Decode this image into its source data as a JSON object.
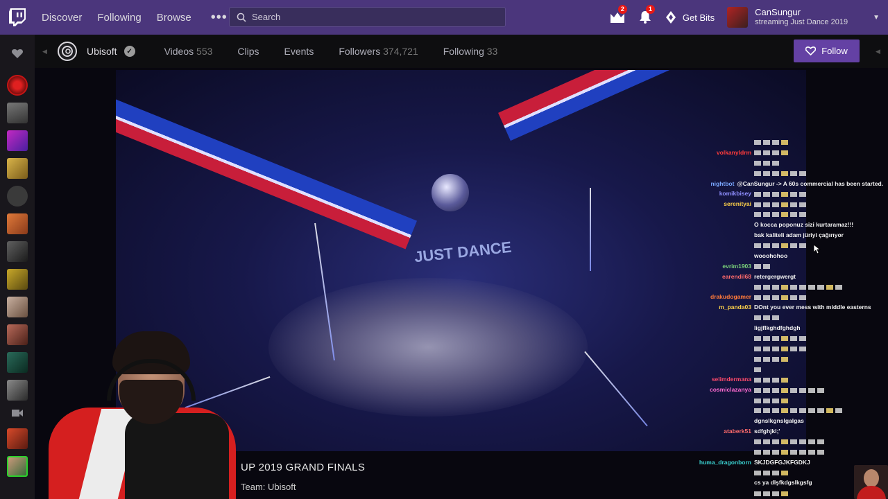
{
  "nav": {
    "links": [
      "Discover",
      "Following",
      "Browse"
    ],
    "search_placeholder": "Search",
    "prime_badge": "2",
    "notif_badge": "1",
    "bits_label": "Get Bits",
    "user_name": "CanSungur",
    "user_status": "streaming Just Dance 2019"
  },
  "channel": {
    "name": "Ubisoft",
    "tabs": [
      {
        "label": "Videos",
        "count": "553"
      },
      {
        "label": "Clips",
        "count": ""
      },
      {
        "label": "Events",
        "count": ""
      },
      {
        "label": "Followers",
        "count": "374,721"
      },
      {
        "label": "Following",
        "count": "33"
      }
    ],
    "follow_label": "Follow"
  },
  "video": {
    "caption_title": "UP 2019 GRAND FINALS",
    "caption_team": "Team:  Ubisoft"
  },
  "chat": [
    {
      "user": "",
      "color": "#e0e0e0",
      "text": "",
      "emotes": 4
    },
    {
      "user": "volkanyldrm",
      "color": "#ff3b3b",
      "text": "",
      "emotes": 4
    },
    {
      "user": "",
      "color": "#e0e0e0",
      "text": "",
      "emotes": 3
    },
    {
      "user": "",
      "color": "#ff3b3b",
      "text": "",
      "emotes": 6
    },
    {
      "user": "nightbot",
      "color": "#7aa7ff",
      "text": "@CanSungur -> A 60s commercial has been started.",
      "emotes": 0
    },
    {
      "user": "komikbisey",
      "color": "#8f8fff",
      "text": "",
      "emotes": 6
    },
    {
      "user": "serenityai",
      "color": "#ffd24a",
      "text": "",
      "emotes": 6
    },
    {
      "user": "",
      "color": "#e0e0e0",
      "text": "",
      "emotes": 6
    },
    {
      "user": "",
      "color": "#ff3b3b",
      "text": "O kocca poponuz sizi kurtaramaz!!!",
      "emotes": 0
    },
    {
      "user": "",
      "color": "#3ad13a",
      "text": "bak kaliteli adam jüriyi çağırıyor",
      "emotes": 0
    },
    {
      "user": "",
      "color": "#ff3b3b",
      "text": "",
      "emotes": 6
    },
    {
      "user": "",
      "color": "#b36bff",
      "text": "wooohohoo",
      "emotes": 0
    },
    {
      "user": "evrim1903",
      "color": "#7ad17a",
      "text": "",
      "emotes": 2
    },
    {
      "user": "earendil68",
      "color": "#ff6b6b",
      "text": "retergergwergt",
      "emotes": 0
    },
    {
      "user": "",
      "color": "#ff3b3b",
      "text": "",
      "emotes": 10
    },
    {
      "user": "drakudogamer",
      "color": "#ff7a3a",
      "text": "",
      "emotes": 6
    },
    {
      "user": "m_panda03",
      "color": "#ffd24a",
      "text": "DOnt you ever mess with middle easterns",
      "emotes": 0
    },
    {
      "user": "",
      "color": "#4a9aff",
      "text": "",
      "emotes": 3
    },
    {
      "user": "",
      "color": "#e0e0e0",
      "text": "ligjflkghdfghdgh",
      "emotes": 0
    },
    {
      "user": "",
      "color": "#b36bff",
      "text": "",
      "emotes": 6
    },
    {
      "user": "",
      "color": "#ff3b3b",
      "text": "",
      "emotes": 6
    },
    {
      "user": "",
      "color": "#ff3b3b",
      "text": "",
      "emotes": 4
    },
    {
      "user": "",
      "color": "#e0e0e0",
      "text": "",
      "emotes": 1
    },
    {
      "user": "selimdermana",
      "color": "#ff4a6b",
      "text": "",
      "emotes": 4
    },
    {
      "user": "cosmiclazanya",
      "color": "#ff6bd1",
      "text": "",
      "emotes": 8
    },
    {
      "user": "",
      "color": "#ff3b3b",
      "text": "",
      "emotes": 4
    },
    {
      "user": "",
      "color": "#ff3b3b",
      "text": "",
      "emotes": 10
    },
    {
      "user": "",
      "color": "#e0e0e0",
      "text": "dgnslkgnslgalgas",
      "emotes": 0
    },
    {
      "user": "ataberk51",
      "color": "#ff6b6b",
      "text": "sdfghjkl;'",
      "emotes": 0
    },
    {
      "user": "",
      "color": "#ff8a3a",
      "text": "",
      "emotes": 8
    },
    {
      "user": "",
      "color": "#b36bff",
      "text": "",
      "emotes": 8
    },
    {
      "user": "huma_dragonborn",
      "color": "#3ad1d1",
      "text": "SKJDGFGJKFGDKJ",
      "emotes": 0
    },
    {
      "user": "",
      "color": "#ff3b3b",
      "text": "",
      "emotes": 4
    },
    {
      "user": "",
      "color": "#ff3b3b",
      "text": "cs ya dlşfkdgslkgsfg",
      "emotes": 0
    },
    {
      "user": "",
      "color": "#ff3b3b",
      "text": "",
      "emotes": 4
    }
  ]
}
